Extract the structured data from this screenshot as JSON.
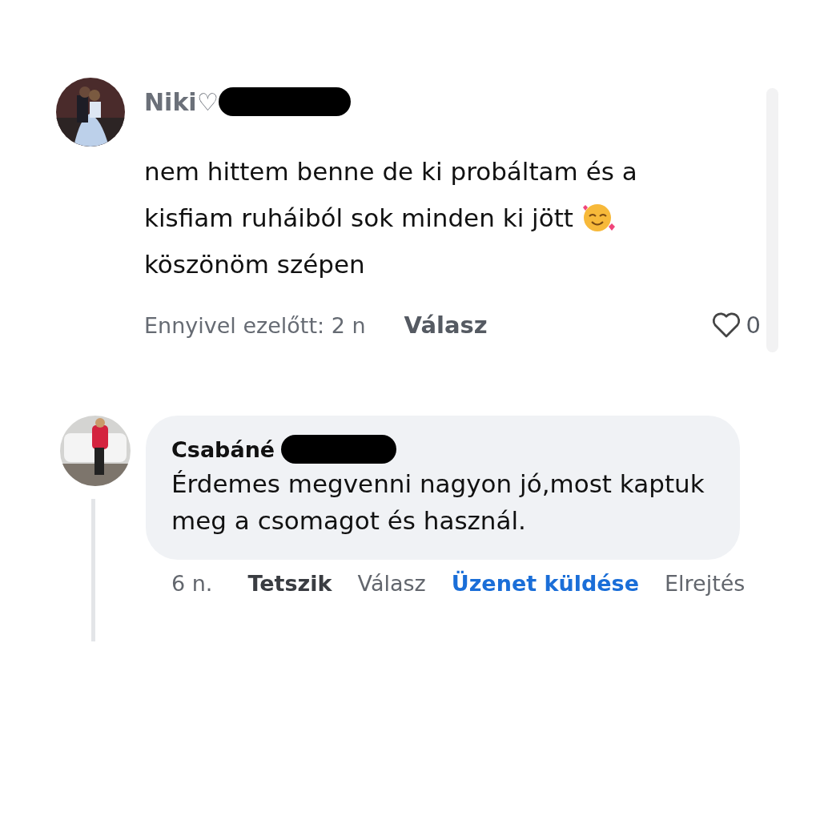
{
  "comments": [
    {
      "author": "Niki♡",
      "text": "nem hittem benne de ki probáltam és a kisfiam ruháiból sok minden ki jött",
      "closing": "köszönöm szépen",
      "time": "Ennyivel ezelőtt: 2 n",
      "reply": "Válasz",
      "likes": "0"
    },
    {
      "author": "Csabáné",
      "text": "Érdemes megvenni nagyon jó,most kaptuk meg a csomagot és használ.",
      "time": "6 n.",
      "actions": [
        {
          "label": "Tetszik",
          "kind": "bold"
        },
        {
          "label": "Válasz",
          "kind": "plain"
        },
        {
          "label": "Üzenet küldése",
          "kind": "link"
        },
        {
          "label": "Elrejtés",
          "kind": "plain"
        }
      ]
    }
  ]
}
